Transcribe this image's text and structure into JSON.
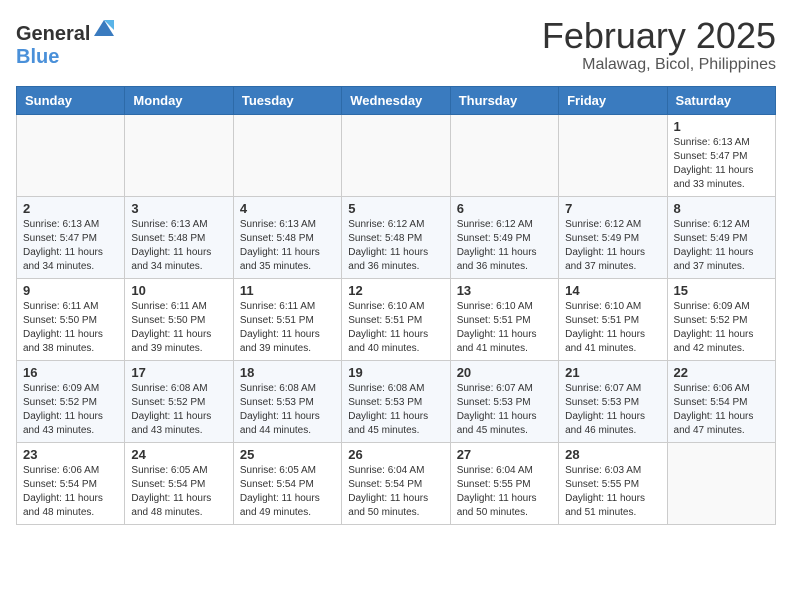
{
  "header": {
    "logo_general": "General",
    "logo_blue": "Blue",
    "title": "February 2025",
    "subtitle": "Malawag, Bicol, Philippines"
  },
  "days_of_week": [
    "Sunday",
    "Monday",
    "Tuesday",
    "Wednesday",
    "Thursday",
    "Friday",
    "Saturday"
  ],
  "weeks": [
    [
      {
        "day": "",
        "info": ""
      },
      {
        "day": "",
        "info": ""
      },
      {
        "day": "",
        "info": ""
      },
      {
        "day": "",
        "info": ""
      },
      {
        "day": "",
        "info": ""
      },
      {
        "day": "",
        "info": ""
      },
      {
        "day": "1",
        "info": "Sunrise: 6:13 AM\nSunset: 5:47 PM\nDaylight: 11 hours and 33 minutes."
      }
    ],
    [
      {
        "day": "2",
        "info": "Sunrise: 6:13 AM\nSunset: 5:47 PM\nDaylight: 11 hours and 34 minutes."
      },
      {
        "day": "3",
        "info": "Sunrise: 6:13 AM\nSunset: 5:48 PM\nDaylight: 11 hours and 34 minutes."
      },
      {
        "day": "4",
        "info": "Sunrise: 6:13 AM\nSunset: 5:48 PM\nDaylight: 11 hours and 35 minutes."
      },
      {
        "day": "5",
        "info": "Sunrise: 6:12 AM\nSunset: 5:48 PM\nDaylight: 11 hours and 36 minutes."
      },
      {
        "day": "6",
        "info": "Sunrise: 6:12 AM\nSunset: 5:49 PM\nDaylight: 11 hours and 36 minutes."
      },
      {
        "day": "7",
        "info": "Sunrise: 6:12 AM\nSunset: 5:49 PM\nDaylight: 11 hours and 37 minutes."
      },
      {
        "day": "8",
        "info": "Sunrise: 6:12 AM\nSunset: 5:49 PM\nDaylight: 11 hours and 37 minutes."
      }
    ],
    [
      {
        "day": "9",
        "info": "Sunrise: 6:11 AM\nSunset: 5:50 PM\nDaylight: 11 hours and 38 minutes."
      },
      {
        "day": "10",
        "info": "Sunrise: 6:11 AM\nSunset: 5:50 PM\nDaylight: 11 hours and 39 minutes."
      },
      {
        "day": "11",
        "info": "Sunrise: 6:11 AM\nSunset: 5:51 PM\nDaylight: 11 hours and 39 minutes."
      },
      {
        "day": "12",
        "info": "Sunrise: 6:10 AM\nSunset: 5:51 PM\nDaylight: 11 hours and 40 minutes."
      },
      {
        "day": "13",
        "info": "Sunrise: 6:10 AM\nSunset: 5:51 PM\nDaylight: 11 hours and 41 minutes."
      },
      {
        "day": "14",
        "info": "Sunrise: 6:10 AM\nSunset: 5:51 PM\nDaylight: 11 hours and 41 minutes."
      },
      {
        "day": "15",
        "info": "Sunrise: 6:09 AM\nSunset: 5:52 PM\nDaylight: 11 hours and 42 minutes."
      }
    ],
    [
      {
        "day": "16",
        "info": "Sunrise: 6:09 AM\nSunset: 5:52 PM\nDaylight: 11 hours and 43 minutes."
      },
      {
        "day": "17",
        "info": "Sunrise: 6:08 AM\nSunset: 5:52 PM\nDaylight: 11 hours and 43 minutes."
      },
      {
        "day": "18",
        "info": "Sunrise: 6:08 AM\nSunset: 5:53 PM\nDaylight: 11 hours and 44 minutes."
      },
      {
        "day": "19",
        "info": "Sunrise: 6:08 AM\nSunset: 5:53 PM\nDaylight: 11 hours and 45 minutes."
      },
      {
        "day": "20",
        "info": "Sunrise: 6:07 AM\nSunset: 5:53 PM\nDaylight: 11 hours and 45 minutes."
      },
      {
        "day": "21",
        "info": "Sunrise: 6:07 AM\nSunset: 5:53 PM\nDaylight: 11 hours and 46 minutes."
      },
      {
        "day": "22",
        "info": "Sunrise: 6:06 AM\nSunset: 5:54 PM\nDaylight: 11 hours and 47 minutes."
      }
    ],
    [
      {
        "day": "23",
        "info": "Sunrise: 6:06 AM\nSunset: 5:54 PM\nDaylight: 11 hours and 48 minutes."
      },
      {
        "day": "24",
        "info": "Sunrise: 6:05 AM\nSunset: 5:54 PM\nDaylight: 11 hours and 48 minutes."
      },
      {
        "day": "25",
        "info": "Sunrise: 6:05 AM\nSunset: 5:54 PM\nDaylight: 11 hours and 49 minutes."
      },
      {
        "day": "26",
        "info": "Sunrise: 6:04 AM\nSunset: 5:54 PM\nDaylight: 11 hours and 50 minutes."
      },
      {
        "day": "27",
        "info": "Sunrise: 6:04 AM\nSunset: 5:55 PM\nDaylight: 11 hours and 50 minutes."
      },
      {
        "day": "28",
        "info": "Sunrise: 6:03 AM\nSunset: 5:55 PM\nDaylight: 11 hours and 51 minutes."
      },
      {
        "day": "",
        "info": ""
      }
    ]
  ]
}
